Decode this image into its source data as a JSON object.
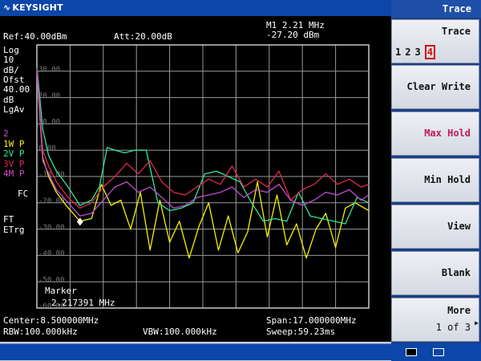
{
  "header": {
    "brand": "KEYSIGHT"
  },
  "settings": {
    "ref": "Ref:40.00dBm",
    "att": "Att:20.00dB",
    "marker_line1": "M1 2.21 MHz",
    "marker_line2": "-27.20 dBm"
  },
  "left_labels": [
    "Log",
    "10",
    "dB/",
    "Ofst",
    "40.00",
    "dB",
    "LgAv"
  ],
  "trace_labels": [
    {
      "text": "2",
      "color": "#d04cc8"
    },
    {
      "text": "1W P",
      "color": "#f2f200"
    },
    {
      "text": "2V P",
      "color": "#2ee89a"
    },
    {
      "text": "3V P",
      "color": "#e02a4a"
    },
    {
      "text": "4M P",
      "color": "#d04cc8"
    }
  ],
  "fc_label": "FC",
  "ft_label": "FT",
  "etrg_label": "ETrg",
  "y_ticks": [
    "30.00",
    "20.00",
    "10.00",
    "0.00",
    "-10.00",
    "-20.00",
    "-30.00",
    "-40.00",
    "-50.00",
    "-60.00"
  ],
  "marker_box": {
    "title": "Marker",
    "value": "2.217391 MHz"
  },
  "footer": {
    "center": "Center:8.500000MHz",
    "span": "Span:17.000000MHz",
    "rbw": "RBW:100.000kHz",
    "vbw": "VBW:100.000kHz",
    "sweep": "Sweep:59.23ms"
  },
  "panel": {
    "title": "Trace",
    "softkeys": [
      {
        "label": "Trace",
        "extra": "1 2 3 4",
        "selected": "4"
      },
      {
        "label": "Clear Write"
      },
      {
        "label": "Max Hold",
        "active": true
      },
      {
        "label": "Min Hold"
      },
      {
        "label": "View"
      },
      {
        "label": "Blank"
      },
      {
        "label": "More",
        "sub": "1 of 3"
      }
    ]
  },
  "colors": {
    "trace1": "#f2f200",
    "trace2": "#2ee89a",
    "trace3": "#e02a4a",
    "trace4": "#c04cd0",
    "grid": "#9a9a9a",
    "tick": "#7a7a7a"
  },
  "chart_data": {
    "type": "line",
    "title": "",
    "xlabel": "",
    "ylabel": "",
    "x_range_mhz": [
      0,
      17
    ],
    "ylim": [
      -60,
      40
    ],
    "y_unit": "dBm",
    "series": [
      {
        "name": "1W P",
        "color": "#f2f200",
        "x": [
          0,
          0.3,
          0.6,
          1.0,
          1.5,
          2.2,
          2.8,
          3.3,
          3.8,
          4.3,
          4.8,
          5.3,
          5.8,
          6.3,
          6.8,
          7.3,
          7.8,
          8.3,
          8.8,
          9.3,
          9.8,
          10.3,
          10.8,
          11.3,
          11.8,
          12.3,
          12.8,
          13.3,
          13.8,
          14.3,
          14.8,
          15.3,
          15.8,
          16.3,
          17.0
        ],
        "y": [
          30,
          -3,
          -10,
          -16,
          -21,
          -27,
          -26,
          -13,
          -21,
          -19,
          -30,
          -16,
          -38,
          -19,
          -35,
          -27,
          -41,
          -29,
          -20,
          -38,
          -25,
          -39,
          -31,
          -12,
          -33,
          -17,
          -36,
          -28,
          -41,
          -30,
          -24,
          -37,
          -22,
          -20,
          -23
        ]
      },
      {
        "name": "2V P",
        "color": "#2ee89a",
        "x": [
          0,
          0.3,
          0.6,
          1.0,
          1.6,
          2.2,
          2.8,
          3.2,
          3.6,
          4.0,
          4.5,
          5.0,
          5.6,
          6.2,
          6.8,
          7.4,
          8.0,
          8.6,
          9.2,
          9.8,
          10.4,
          11.0,
          11.6,
          12.2,
          12.8,
          13.4,
          14.0,
          14.6,
          15.2,
          15.8,
          16.4,
          17.0
        ],
        "y": [
          32,
          8,
          -2,
          -8,
          -14,
          -21,
          -19,
          -14,
          1,
          0,
          -1,
          0,
          0,
          -20,
          -23,
          -22,
          -20,
          -9,
          -8,
          -10,
          -12,
          -20,
          -27,
          -26,
          -27,
          -16,
          -25,
          -26,
          -27,
          -28,
          -18,
          -20
        ]
      },
      {
        "name": "3V P",
        "color": "#e02a4a",
        "x": [
          0,
          0.3,
          0.6,
          1.0,
          1.6,
          2.2,
          2.8,
          3.4,
          4.0,
          4.6,
          5.2,
          5.8,
          6.4,
          7.0,
          7.6,
          8.2,
          8.8,
          9.4,
          10.0,
          10.6,
          11.2,
          11.8,
          12.4,
          13.0,
          13.6,
          14.2,
          14.8,
          15.4,
          16.0,
          16.6,
          17.0
        ],
        "y": [
          31,
          0,
          -6,
          -12,
          -18,
          -22,
          -20,
          -14,
          -10,
          -5,
          -9,
          -4,
          -12,
          -16,
          -17,
          -14,
          -11,
          -13,
          -6,
          -14,
          -11,
          -14,
          -8,
          -19,
          -15,
          -13,
          -9,
          -13,
          -11,
          -14,
          -13
        ]
      },
      {
        "name": "4M P",
        "color": "#c04cd0",
        "x": [
          0,
          0.3,
          0.6,
          1.0,
          1.6,
          2.2,
          2.8,
          3.4,
          4.0,
          4.6,
          5.2,
          5.8,
          6.4,
          7.0,
          7.6,
          8.2,
          8.8,
          9.4,
          10.0,
          10.6,
          11.2,
          11.8,
          12.4,
          13.0,
          13.6,
          14.2,
          14.8,
          15.4,
          16.0,
          16.6,
          17.0
        ],
        "y": [
          30,
          -4,
          -9,
          -15,
          -20,
          -25,
          -24,
          -19,
          -14,
          -12,
          -16,
          -14,
          -18,
          -22,
          -21,
          -18,
          -17,
          -16,
          -14,
          -18,
          -15,
          -16,
          -13,
          -19,
          -21,
          -19,
          -16,
          -17,
          -15,
          -19,
          -17
        ]
      }
    ]
  }
}
